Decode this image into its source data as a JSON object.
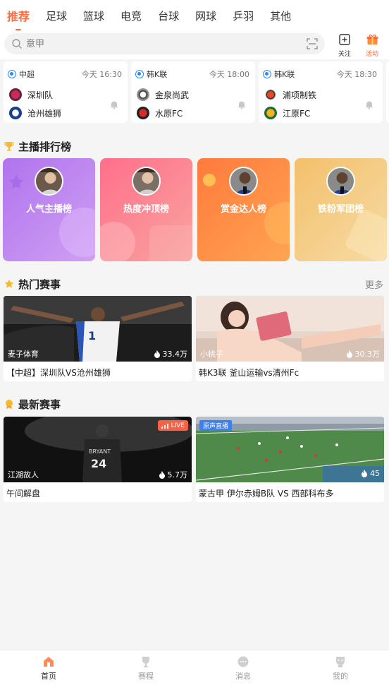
{
  "tabs": [
    "推荐",
    "足球",
    "篮球",
    "电竞",
    "台球",
    "网球",
    "乒羽",
    "其他"
  ],
  "search": {
    "placeholder": "意甲"
  },
  "header_buttons": {
    "follow": "关注",
    "event": "活动"
  },
  "matches": [
    {
      "league": "中超",
      "time": "今天 16:30",
      "home": "深圳队",
      "away": "沧州雄狮"
    },
    {
      "league": "韩K联",
      "time": "今天 18:00",
      "home": "金泉尚武",
      "away": "水原FC"
    },
    {
      "league": "韩K联",
      "time": "今天 18:30",
      "home": "浦项制铁",
      "away": "江原FC"
    }
  ],
  "rank_section": {
    "title": "主播排行榜",
    "cards": [
      {
        "label": "人气主播榜",
        "color_from": "#b77cf1",
        "color_to": "#c392ee"
      },
      {
        "label": "热度冲顶榜",
        "color_from": "#ff6f8a",
        "color_to": "#f9a1a4"
      },
      {
        "label": "赏金达人榜",
        "color_from": "#ff7a3d",
        "color_to": "#ffa04e"
      },
      {
        "label": "铁粉军团榜",
        "color_from": "#f4c06a",
        "color_to": "#f6d396"
      }
    ]
  },
  "hot_section": {
    "title": "热门赛事",
    "more": "更多",
    "cards": [
      {
        "streamer": "麦子体育",
        "heat": "33.4万",
        "title": "【中超】深圳队VS沧州雄狮"
      },
      {
        "streamer": "小桃子",
        "heat": "30.3万",
        "title": "韩K3联 釜山运输vs清州Fc"
      }
    ]
  },
  "new_section": {
    "title": "最新赛事",
    "cards": [
      {
        "streamer": "江湖故人",
        "heat": "5.7万",
        "title": "午间解盘",
        "badge": "LIVE"
      },
      {
        "streamer": "",
        "heat": "45",
        "title": "蒙古甲 伊尔赤姆B队 VS 西部科布多",
        "badge": "原声直播"
      }
    ]
  },
  "bottom_nav": [
    "首页",
    "赛程",
    "消息",
    "我的"
  ],
  "colors": {
    "accent": "#ff6a3d"
  }
}
